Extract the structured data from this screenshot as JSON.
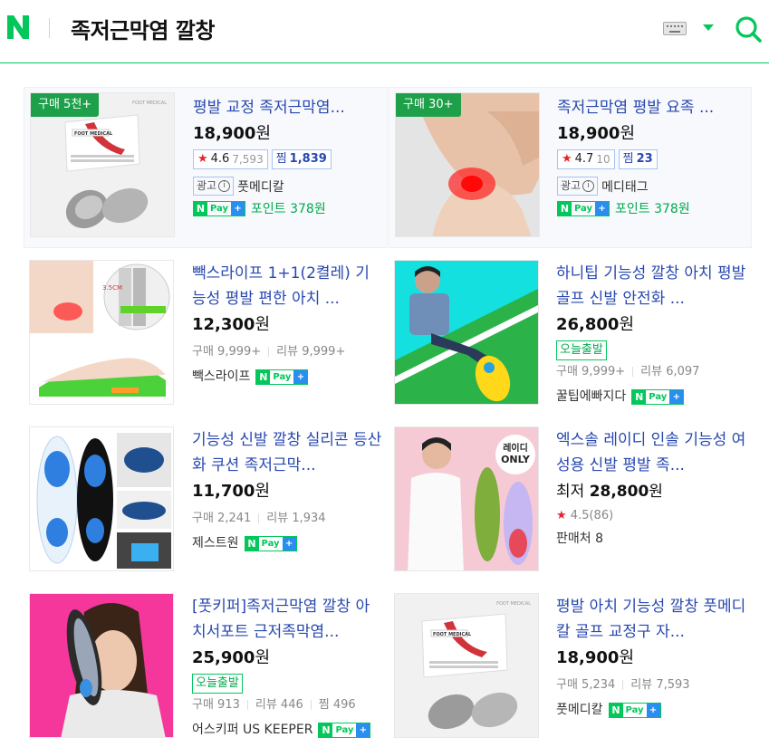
{
  "header": {
    "logo": "N",
    "query": "족저근막염 깔창",
    "icons": [
      "keyboard-icon",
      "dropdown-caret-icon",
      "search-icon"
    ],
    "colors": {
      "brand": "#03c75a",
      "link": "#2848b0",
      "star": "#e2262d"
    }
  },
  "products": [
    {
      "badge": "구매 5천+",
      "title": "평발 교정 족저근막염...",
      "price": "18,900",
      "won": "원",
      "rating": "4.6",
      "rating_count": "7,593",
      "zzim_label": "찜",
      "zzim_count": "1,839",
      "ad_label": "광고",
      "seller": "풋메디칼",
      "npay_text": "Pay",
      "point_text": "포인트 378원"
    },
    {
      "badge": "구매 30+",
      "title": "족저근막염 평발 요족 ...",
      "price": "18,900",
      "won": "원",
      "rating": "4.7",
      "rating_count": "10",
      "zzim_label": "찜",
      "zzim_count": "23",
      "ad_label": "광고",
      "seller": "메디태그",
      "npay_text": "Pay",
      "point_text": "포인트 378원"
    },
    {
      "title": "빽스라이프 1+1(2켤레) 기능성 평발 편한 아치 ...",
      "price": "12,300",
      "won": "원",
      "purchase": "구매 9,999+",
      "review": "리뷰 9,999+",
      "seller": "빽스라이프",
      "npay_text": "Pay"
    },
    {
      "title": "하니팁 기능성 깔창 아치 평발 골프 신발 안전화 ...",
      "price": "26,800",
      "won": "원",
      "today": "오늘출발",
      "purchase": "구매 9,999+",
      "review": "리뷰 6,097",
      "seller": "꿀팁에빠지다",
      "npay_text": "Pay"
    },
    {
      "title": "기능성 신발 깔창 실리콘 등산화 쿠션 족저근막...",
      "price": "11,700",
      "won": "원",
      "purchase": "구매 2,241",
      "review": "리뷰 1,934",
      "seller": "제스트원",
      "npay_text": "Pay"
    },
    {
      "title": "엑스솔 레이디 인솔 기능성 여성용 신발 평발 족...",
      "lowest_label": "최저",
      "price": "28,800",
      "won": "원",
      "rating_text": "4.5(86)",
      "sellers": "판매처 8",
      "badge_text": "레이디 ONLY"
    },
    {
      "title": "[풋키퍼]족저근막염 깔창 아치서포트 근저족막염...",
      "price": "25,900",
      "won": "원",
      "today": "오늘출발",
      "purchase": "구매 913",
      "review": "리뷰 446",
      "zzim": "찜 496",
      "seller": "어스키퍼 US KEEPER",
      "npay_text": "Pay"
    },
    {
      "title": "평발 아치 기능성 깔창 풋메디칼 골프 교정구 자...",
      "price": "18,900",
      "won": "원",
      "purchase": "구매 5,234",
      "review": "리뷰 7,593",
      "seller": "풋메디칼",
      "npay_text": "Pay"
    }
  ],
  "image_text": {
    "foot_medical": "FOOT MEDICAL",
    "ruler_mark": "3.5CM",
    "lady_only_1": "레이디",
    "lady_only_2": "ONLY"
  }
}
